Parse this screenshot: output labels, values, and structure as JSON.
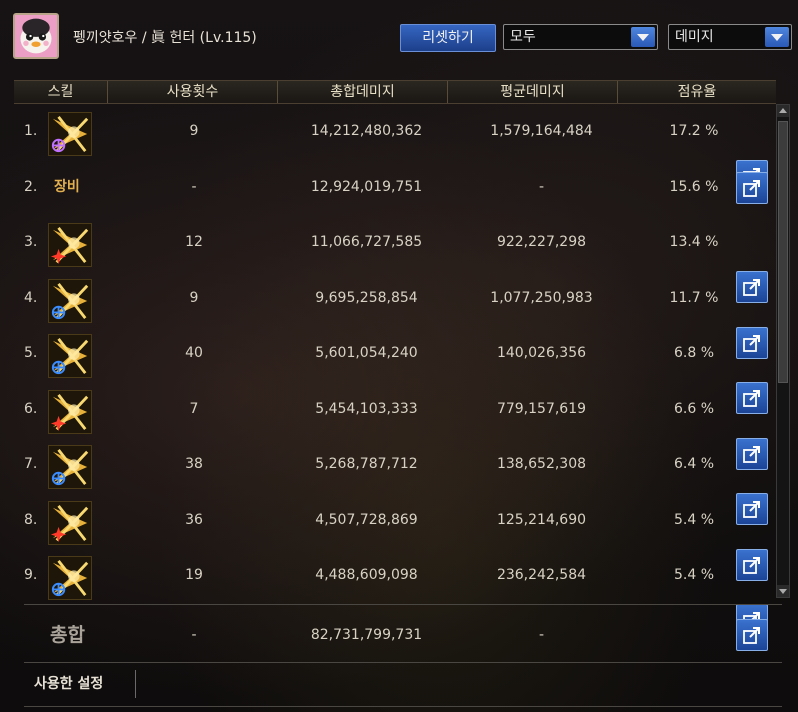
{
  "header": {
    "character_name": "펭끼얏호우 / 眞 헌터 (Lv.115)",
    "reset_label": "리셋하기",
    "filter_select": "모두",
    "type_select": "데미지"
  },
  "table": {
    "columns": [
      "스킬",
      "사용횟수",
      "총합데미지",
      "평균데미지",
      "점유율"
    ],
    "rows": [
      {
        "index": "1.",
        "icon": "skill-icon-purple-rune",
        "name": "",
        "count": "9",
        "total": "14,212,480,362",
        "avg": "1,579,164,484",
        "share": "17.2 %"
      },
      {
        "index": "2.",
        "icon": "",
        "name": "장비",
        "count": "-",
        "total": "12,924,019,751",
        "avg": "-",
        "share": "15.6 %"
      },
      {
        "index": "3.",
        "icon": "skill-icon-red-burst",
        "name": "",
        "count": "12",
        "total": "11,066,727,585",
        "avg": "922,227,298",
        "share": "13.4 %"
      },
      {
        "index": "4.",
        "icon": "skill-icon-blue-crosshair",
        "name": "",
        "count": "9",
        "total": "9,695,258,854",
        "avg": "1,077,250,983",
        "share": "11.7 %"
      },
      {
        "index": "5.",
        "icon": "skill-icon-blue-crosshair",
        "name": "",
        "count": "40",
        "total": "5,601,054,240",
        "avg": "140,026,356",
        "share": "6.8 %"
      },
      {
        "index": "6.",
        "icon": "skill-icon-red-burst",
        "name": "",
        "count": "7",
        "total": "5,454,103,333",
        "avg": "779,157,619",
        "share": "6.6 %"
      },
      {
        "index": "7.",
        "icon": "skill-icon-blue-crosshair",
        "name": "",
        "count": "38",
        "total": "5,268,787,712",
        "avg": "138,652,308",
        "share": "6.4 %"
      },
      {
        "index": "8.",
        "icon": "skill-icon-red-burst",
        "name": "",
        "count": "36",
        "total": "4,507,728,869",
        "avg": "125,214,690",
        "share": "5.4 %"
      },
      {
        "index": "9.",
        "icon": "skill-icon-blue-crosshair",
        "name": "",
        "count": "19",
        "total": "4,488,609,098",
        "avg": "236,242,584",
        "share": "5.4 %"
      }
    ]
  },
  "total": {
    "label": "총합",
    "count": "-",
    "total": "82,731,799,731",
    "avg": "-"
  },
  "settings": {
    "label": "사용한 설정"
  },
  "colors": {
    "accent_blue": "#2a58b6",
    "gold": "#e3b050"
  }
}
